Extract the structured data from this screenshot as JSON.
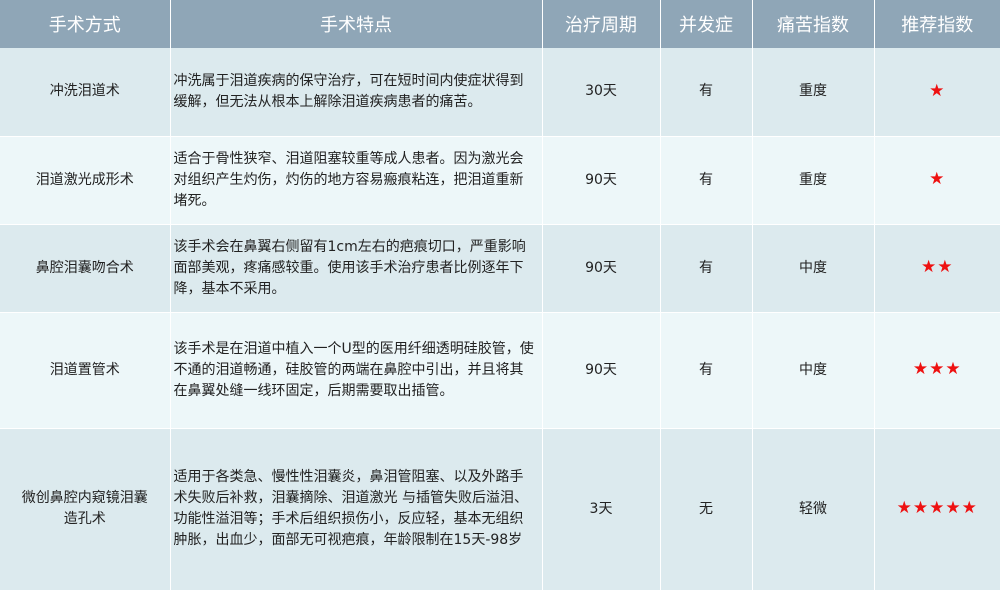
{
  "headers": [
    "手术方式",
    "手术特点",
    "治疗周期",
    "并发症",
    "痛苦指数",
    "推荐指数"
  ],
  "rows": [
    {
      "method": "冲洗泪道术",
      "feature": "冲洗属于泪道疾病的保守治疗，可在短时间内使症状得到缓解，但无法从根本上解除泪道疾病患者的痛苦。",
      "period": "30天",
      "complication": "有",
      "pain": "重度",
      "stars": "★"
    },
    {
      "method": "泪道激光成形术",
      "feature": "适合于骨性狭窄、泪道阻塞较重等成人患者。因为激光会对组织产生灼伤，灼伤的地方容易瘢痕粘连，把泪道重新堵死。",
      "period": "90天",
      "complication": "有",
      "pain": "重度",
      "stars": "★"
    },
    {
      "method": "鼻腔泪囊吻合术",
      "feature": "该手术会在鼻翼右侧留有1cm左右的疤痕切口，严重影响面部美观，疼痛感较重。使用该手术治疗患者比例逐年下降，基本不采用。",
      "period": "90天",
      "complication": "有",
      "pain": "中度",
      "stars": "★★"
    },
    {
      "method": "泪道置管术",
      "feature": "该手术是在泪道中植入一个U型的医用纤细透明硅胶管，使不通的泪道畅通，硅胶管的两端在鼻腔中引出，并且将其在鼻翼处缝一线环固定，后期需要取出插管。",
      "period": "90天",
      "complication": "有",
      "pain": "中度",
      "stars": "★★★"
    },
    {
      "method": "微创鼻腔内窥镜泪囊造孔术",
      "feature": "适用于各类急、慢性性泪囊炎，鼻泪管阻塞、以及外路手术失败后补救，泪囊摘除、泪道激光 与插管失败后溢泪、功能性溢泪等；手术后组织损伤小，反应轻，基本无组织肿胀，出血少，面部无可视疤痕，年龄限制在15天-98岁",
      "period": "3天",
      "complication": "无",
      "pain": "轻微",
      "stars": "★★★★★"
    }
  ]
}
